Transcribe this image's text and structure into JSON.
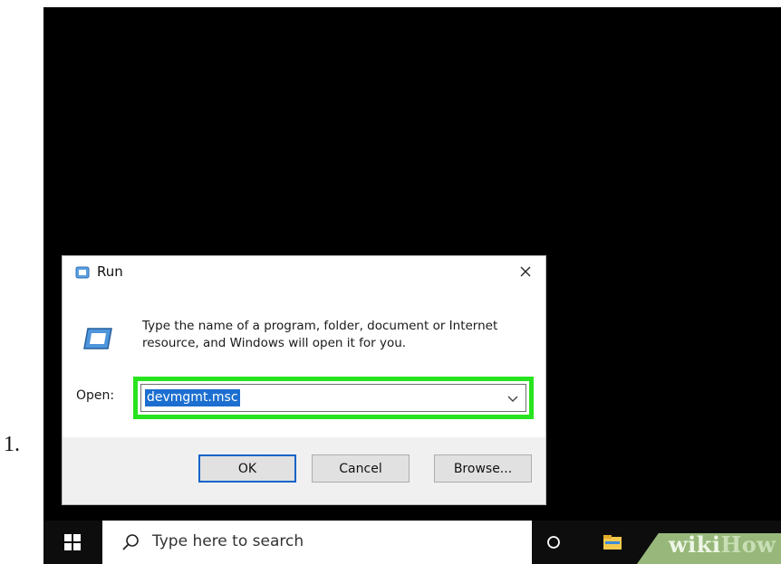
{
  "step": {
    "number": "1."
  },
  "dialog": {
    "title": "Run",
    "description": "Type the name of a program, folder, document or Internet resource, and Windows will open it for you.",
    "open_label": "Open:",
    "open_value": "devmgmt.msc",
    "buttons": {
      "ok": "OK",
      "cancel": "Cancel",
      "browse": "Browse..."
    }
  },
  "taskbar": {
    "search_placeholder": "Type here to search",
    "watermark": {
      "part1": "wiki",
      "part2": "How"
    }
  },
  "colors": {
    "highlight": "#27e41e",
    "selection": "#1c6fd0",
    "taskbar": "#0d0d0d"
  },
  "icons": [
    "run-icon",
    "close-icon",
    "chevron-down-icon",
    "windows-start-icon",
    "search-icon",
    "task-view-icon",
    "file-explorer-icon"
  ]
}
